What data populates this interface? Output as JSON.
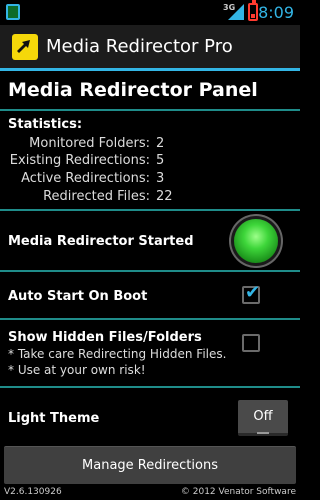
{
  "status_bar": {
    "network": "3G",
    "time": "8:09",
    "notification_icon": "app-notification-icon",
    "signal_icon": "signal-icon",
    "battery_icon": "battery-low-icon"
  },
  "action_bar": {
    "title": "Media Redirector Pro",
    "icon": "media-redirector-icon"
  },
  "panel": {
    "title": "Media Redirector Panel"
  },
  "statistics": {
    "title": "Statistics:",
    "rows": [
      {
        "label": "Monitored Folders:",
        "value": "2"
      },
      {
        "label": "Existing Redirections:",
        "value": "5"
      },
      {
        "label": "Active Redirections:",
        "value": "3"
      },
      {
        "label": "Redirected Files:",
        "value": "22"
      }
    ]
  },
  "service": {
    "label": "Media Redirector Started",
    "status_color": "#3ed63a"
  },
  "auto_start": {
    "label": "Auto Start On Boot",
    "checked": true
  },
  "hidden_files": {
    "label": "Show Hidden Files/Folders",
    "checked": false,
    "notes": [
      "* Take care Redirecting Hidden Files.",
      "* Use at your own risk!"
    ]
  },
  "light_theme": {
    "label": "Light Theme",
    "toggle_label": "Off"
  },
  "manage_button": {
    "label": "Manage Redirections"
  },
  "footer": {
    "version": "V2.6.130926",
    "copyright": "© 2012 Venator Software"
  },
  "colors": {
    "accent": "#33b5e5",
    "divider": "#1f8c8a",
    "background": "#000000"
  }
}
